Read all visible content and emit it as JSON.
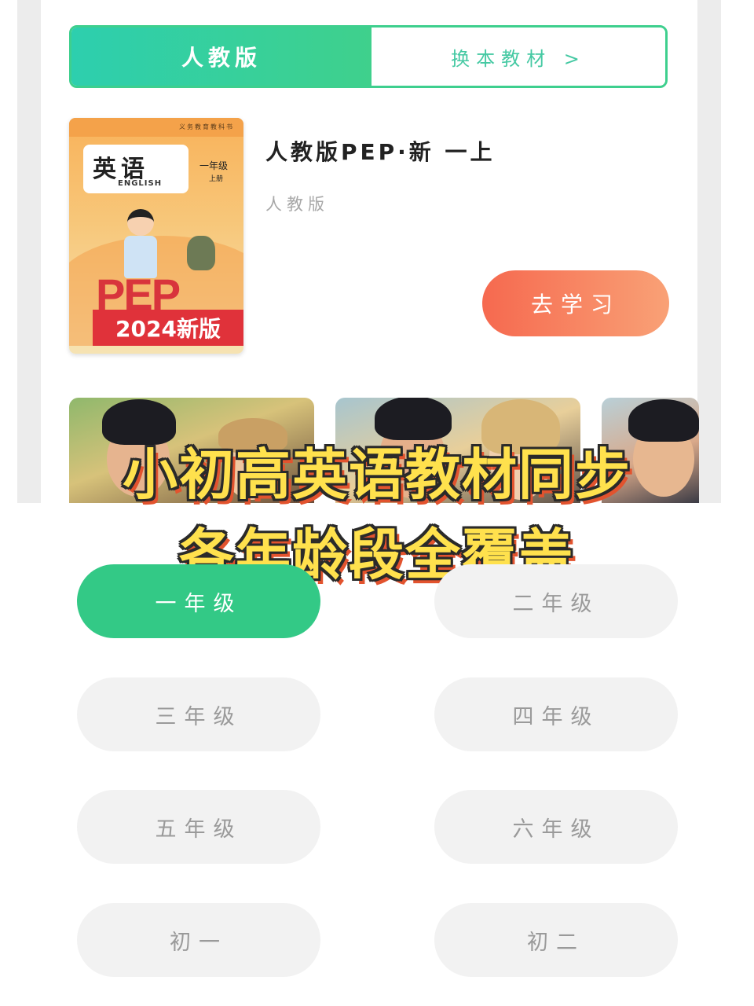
{
  "edition_tabs": {
    "active_label": "人教版",
    "switch_label": "换本教材 >"
  },
  "book": {
    "cover": {
      "publisher_line": "义务教育教科书",
      "title": "英语",
      "english": "ENGLISH",
      "grade": "一年级",
      "term": "上册",
      "logo_text": "PEP",
      "ribbon": "2024新版"
    },
    "title": "人教版PEP·新 一上",
    "edition": "人教版",
    "study_button": "去学习"
  },
  "banner": {
    "line1": "小初高英语教材同步",
    "line2": "各年龄段全覆盖"
  },
  "grades": {
    "selected": "一年级",
    "items": [
      "一年级",
      "二年级",
      "三年级",
      "四年级",
      "五年级",
      "六年级",
      "初一",
      "初二"
    ]
  },
  "colors": {
    "accent_green": "#33c986",
    "button_orange": "#f6694f",
    "banner_yellow": "#ffe14d",
    "banner_shadow": "#e2532e"
  }
}
